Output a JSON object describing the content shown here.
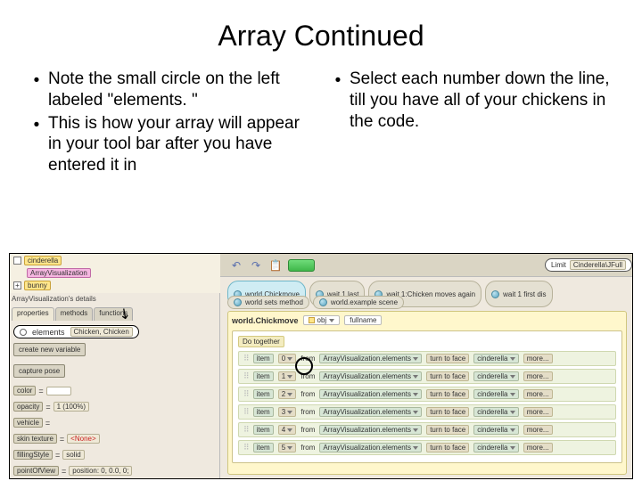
{
  "title": "Array Continued",
  "bullets_left": [
    "Note the small circle on the left labeled \"elements. \"",
    "This is how your array will appear in your tool bar after you have entered it in"
  ],
  "bullets_right": [
    "Select each number down the line, till you have all of your chickens in the code."
  ],
  "screenshot": {
    "tree": {
      "item_top": "cinderella",
      "item_selected": "ArrayVisualization",
      "item_bottom": "bunny"
    },
    "details_title": "ArrayVisualization's details",
    "tabs": [
      "properties",
      "methods",
      "functions"
    ],
    "elements_label": "elements",
    "elements_values": "Chicken, Chicken",
    "create_var_btn": "create new variable",
    "capture_btn": "capture pose",
    "props": [
      {
        "name": "color",
        "value": ""
      },
      {
        "name": "opacity",
        "value": "1 (100%)"
      },
      {
        "name": "vehicle",
        "value": ""
      },
      {
        "name": "skin texture",
        "value": "<None>",
        "red": true
      },
      {
        "name": "fillingStyle",
        "value": "solid"
      },
      {
        "name": "pointOfView",
        "value": "position: 0, 0.0, 0;"
      }
    ],
    "toolbar": {
      "limit_label": "Limit",
      "limit_value": "Cinderella\\JFull"
    },
    "method_tabs_row1": [
      "world.Chickmove",
      "wait 1 last",
      "wait 1:Chicken moves again",
      "wait 1 first dis"
    ],
    "method_tabs_row2": [
      "world sets method",
      "world.example scene"
    ],
    "editor_method": "world.Chickmove",
    "editor_param_1": "obj",
    "editor_param_2": "fullname",
    "do_together": "Do together",
    "item_label": "item",
    "from_label": "from",
    "array_ref": "ArrayVisualization.elements",
    "turn_label": "turn to face",
    "target": "cinderella",
    "more": "more...",
    "indices": [
      "0",
      "1",
      "2",
      "3",
      "4",
      "5"
    ]
  }
}
